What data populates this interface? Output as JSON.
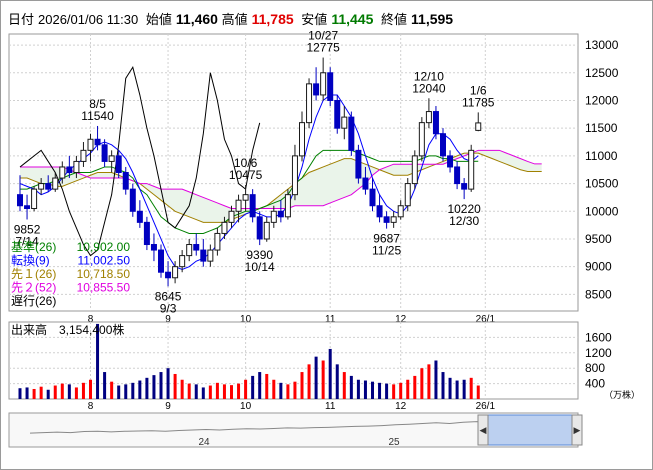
{
  "header": {
    "date_label": "日付",
    "date": "2026/01/06 11:30",
    "open_label": "始値",
    "open": "11,460",
    "high_label": "高値",
    "high": "11,785",
    "low_label": "安値",
    "low": "11,445",
    "close_label": "終値",
    "close": "11,595"
  },
  "colors": {
    "up": "#1a1a1a",
    "down": "#0000c0",
    "kijun": "#008000",
    "tenkan": "#0000ff",
    "senkou1": "#a08000",
    "senkou2": "#e000e0",
    "chikou": "#000000",
    "volume_up": "#ff0000",
    "volume_down": "#000080",
    "cloud": "#eaf4ea",
    "navigator": "#5a8ad8"
  },
  "legend": [
    {
      "label": "基準(26)",
      "value": "10,902.00",
      "color": "#008000"
    },
    {
      "label": "転換(9)",
      "value": "11,002.50",
      "color": "#0000ff"
    },
    {
      "label": "先１(26)",
      "value": "10,718.50",
      "color": "#a08000"
    },
    {
      "label": "先２(52)",
      "value": "10,855.50",
      "color": "#e000e0"
    },
    {
      "label": "遅行(26)",
      "value": "",
      "color": "#000000"
    }
  ],
  "volume_title": "出来高　3,154,400株",
  "volume_unit": "（万株）",
  "navigator": {
    "labels": [
      "24",
      "25"
    ],
    "left_arrow": "◀",
    "right_arrow": "▶"
  },
  "chart_data": {
    "type": "candlestick",
    "y_axis": {
      "ticks": [
        8500,
        9000,
        9500,
        10000,
        10500,
        11000,
        11500,
        12000,
        12500,
        13000
      ],
      "ylim": [
        8200,
        13200
      ]
    },
    "x_axis": {
      "month_labels": [
        "8",
        "9",
        "10",
        "11",
        "12",
        "26/1"
      ]
    },
    "volume_axis": {
      "ticks": [
        400,
        800,
        1200,
        1600
      ]
    },
    "annotations": [
      {
        "text": "8/5",
        "text2": "11540",
        "value": 11540
      },
      {
        "text": "9852",
        "text2": "7/14",
        "value": 9852
      },
      {
        "text": "8645",
        "text2": "9/3",
        "value": 8645
      },
      {
        "text": "10/6",
        "text2": "10475",
        "value": 10475
      },
      {
        "text": "9390",
        "text2": "10/14",
        "value": 9390
      },
      {
        "text": "10/27",
        "text2": "12775",
        "value": 12775
      },
      {
        "text": "9687",
        "text2": "11/25",
        "value": 9687
      },
      {
        "text": "12/10",
        "text2": "12040",
        "value": 12040
      },
      {
        "text": "1/6",
        "text2": "11785",
        "value": 11785
      },
      {
        "text": "10220",
        "text2": "12/30",
        "value": 10220
      }
    ],
    "candles": [
      {
        "o": 10300,
        "h": 10650,
        "l": 10000,
        "c": 10100
      },
      {
        "o": 10100,
        "h": 10300,
        "l": 9852,
        "c": 10050
      },
      {
        "o": 10050,
        "h": 10450,
        "l": 10000,
        "c": 10400
      },
      {
        "o": 10400,
        "h": 10600,
        "l": 10300,
        "c": 10500
      },
      {
        "o": 10500,
        "h": 10650,
        "l": 10350,
        "c": 10400
      },
      {
        "o": 10400,
        "h": 10700,
        "l": 10350,
        "c": 10600
      },
      {
        "o": 10600,
        "h": 10900,
        "l": 10500,
        "c": 10800
      },
      {
        "o": 10800,
        "h": 11000,
        "l": 10600,
        "c": 10700
      },
      {
        "o": 10700,
        "h": 11000,
        "l": 10600,
        "c": 10900
      },
      {
        "o": 10900,
        "h": 11250,
        "l": 10800,
        "c": 11100
      },
      {
        "o": 11100,
        "h": 11400,
        "l": 10900,
        "c": 11300
      },
      {
        "o": 11300,
        "h": 11540,
        "l": 11100,
        "c": 11200
      },
      {
        "o": 11200,
        "h": 11300,
        "l": 10800,
        "c": 10900
      },
      {
        "o": 10900,
        "h": 11100,
        "l": 10700,
        "c": 11000
      },
      {
        "o": 11000,
        "h": 11100,
        "l": 10600,
        "c": 10700
      },
      {
        "o": 10700,
        "h": 10800,
        "l": 10300,
        "c": 10400
      },
      {
        "o": 10400,
        "h": 10500,
        "l": 9900,
        "c": 10000
      },
      {
        "o": 10000,
        "h": 10200,
        "l": 9700,
        "c": 9800
      },
      {
        "o": 9800,
        "h": 9900,
        "l": 9300,
        "c": 9400
      },
      {
        "o": 9400,
        "h": 9600,
        "l": 9100,
        "c": 9300
      },
      {
        "o": 9300,
        "h": 9400,
        "l": 8800,
        "c": 8900
      },
      {
        "o": 8900,
        "h": 9100,
        "l": 8645,
        "c": 8800
      },
      {
        "o": 8800,
        "h": 9100,
        "l": 8700,
        "c": 9000
      },
      {
        "o": 9000,
        "h": 9300,
        "l": 8900,
        "c": 9200
      },
      {
        "o": 9200,
        "h": 9500,
        "l": 9100,
        "c": 9400
      },
      {
        "o": 9400,
        "h": 9600,
        "l": 9200,
        "c": 9300
      },
      {
        "o": 9300,
        "h": 9500,
        "l": 9000,
        "c": 9100
      },
      {
        "o": 9100,
        "h": 9400,
        "l": 9000,
        "c": 9300
      },
      {
        "o": 9300,
        "h": 9700,
        "l": 9200,
        "c": 9600
      },
      {
        "o": 9600,
        "h": 9900,
        "l": 9500,
        "c": 9800
      },
      {
        "o": 9800,
        "h": 10100,
        "l": 9700,
        "c": 10000
      },
      {
        "o": 10000,
        "h": 10300,
        "l": 9800,
        "c": 10200
      },
      {
        "o": 10200,
        "h": 10475,
        "l": 10000,
        "c": 10300
      },
      {
        "o": 10300,
        "h": 10400,
        "l": 9800,
        "c": 9900
      },
      {
        "o": 9900,
        "h": 10000,
        "l": 9390,
        "c": 9500
      },
      {
        "o": 9500,
        "h": 9900,
        "l": 9450,
        "c": 9800
      },
      {
        "o": 9800,
        "h": 10100,
        "l": 9700,
        "c": 10000
      },
      {
        "o": 10000,
        "h": 10200,
        "l": 9800,
        "c": 9900
      },
      {
        "o": 9900,
        "h": 10400,
        "l": 9850,
        "c": 10300
      },
      {
        "o": 10300,
        "h": 11200,
        "l": 10200,
        "c": 11000
      },
      {
        "o": 11000,
        "h": 11800,
        "l": 10900,
        "c": 11600
      },
      {
        "o": 11600,
        "h": 12400,
        "l": 11500,
        "c": 12300
      },
      {
        "o": 12300,
        "h": 12600,
        "l": 12000,
        "c": 12100
      },
      {
        "o": 12100,
        "h": 12775,
        "l": 12000,
        "c": 12500
      },
      {
        "o": 12500,
        "h": 12600,
        "l": 11900,
        "c": 12000
      },
      {
        "o": 12000,
        "h": 12100,
        "l": 11400,
        "c": 11500
      },
      {
        "o": 11500,
        "h": 11900,
        "l": 11300,
        "c": 11700
      },
      {
        "o": 11700,
        "h": 11800,
        "l": 11000,
        "c": 11100
      },
      {
        "o": 11100,
        "h": 11200,
        "l": 10500,
        "c": 10600
      },
      {
        "o": 10600,
        "h": 10800,
        "l": 10300,
        "c": 10400
      },
      {
        "o": 10400,
        "h": 10600,
        "l": 10000,
        "c": 10100
      },
      {
        "o": 10100,
        "h": 10300,
        "l": 9800,
        "c": 9900
      },
      {
        "o": 9900,
        "h": 10000,
        "l": 9687,
        "c": 9800
      },
      {
        "o": 9800,
        "h": 10000,
        "l": 9700,
        "c": 9900
      },
      {
        "o": 9900,
        "h": 10200,
        "l": 9850,
        "c": 10100
      },
      {
        "o": 10100,
        "h": 10600,
        "l": 10000,
        "c": 10500
      },
      {
        "o": 10500,
        "h": 11100,
        "l": 10400,
        "c": 11000
      },
      {
        "o": 11000,
        "h": 11700,
        "l": 10900,
        "c": 11600
      },
      {
        "o": 11600,
        "h": 12040,
        "l": 11500,
        "c": 11800
      },
      {
        "o": 11800,
        "h": 11900,
        "l": 11300,
        "c": 11400
      },
      {
        "o": 11400,
        "h": 11500,
        "l": 10900,
        "c": 11000
      },
      {
        "o": 11000,
        "h": 11100,
        "l": 10700,
        "c": 10800
      },
      {
        "o": 10800,
        "h": 10900,
        "l": 10400,
        "c": 10500
      },
      {
        "o": 10500,
        "h": 10600,
        "l": 10220,
        "c": 10400
      },
      {
        "o": 10400,
        "h": 11200,
        "l": 10350,
        "c": 11100
      },
      {
        "o": 11460,
        "h": 11785,
        "l": 11445,
        "c": 11595
      }
    ],
    "kijun": [
      10400,
      10400,
      10450,
      10500,
      10500,
      10550,
      10600,
      10650,
      10700,
      10700,
      10700,
      10750,
      10800,
      10800,
      10750,
      10700,
      10600,
      10400,
      10300,
      10100,
      9900,
      9800,
      9700,
      9650,
      9600,
      9600,
      9600,
      9650,
      9700,
      9800,
      9900,
      9950,
      10000,
      10000,
      10050,
      10100,
      10150,
      10200,
      10300,
      10500,
      10600,
      10800,
      11000,
      11100,
      11100,
      11100,
      11100,
      11100,
      11050,
      11000,
      10950,
      10900,
      10900,
      10900,
      10900,
      10900,
      10900,
      10950,
      11000,
      11000,
      10950,
      10950,
      10900,
      10900,
      10900,
      10902
    ],
    "tenkan": [
      10500,
      10450,
      10400,
      10300,
      10350,
      10450,
      10600,
      10750,
      10850,
      10950,
      11050,
      11200,
      11250,
      11200,
      11100,
      10950,
      10700,
      10400,
      10100,
      9800,
      9500,
      9200,
      9000,
      8950,
      9000,
      9100,
      9150,
      9250,
      9400,
      9550,
      9700,
      9850,
      9950,
      10000,
      9950,
      9900,
      9900,
      9950,
      10100,
      10400,
      10800,
      11300,
      11700,
      12000,
      12100,
      12100,
      11900,
      11700,
      11400,
      11000,
      10600,
      10300,
      10100,
      10000,
      9950,
      10100,
      10400,
      10800,
      11200,
      11400,
      11400,
      11300,
      11100,
      10950,
      10900,
      11002
    ],
    "senkou1": [
      10600,
      10600,
      10550,
      10500,
      10500,
      10450,
      10450,
      10500,
      10550,
      10600,
      10650,
      10700,
      10700,
      10700,
      10650,
      10600,
      10550,
      10500,
      10400,
      10300,
      10200,
      10100,
      10000,
      9950,
      9900,
      9850,
      9800,
      9800,
      9800,
      9800,
      9850,
      9900,
      9950,
      10000,
      10050,
      10100,
      10200,
      10300,
      10400,
      10500,
      10600,
      10700,
      10750,
      10800,
      10850,
      10900,
      10950,
      10950,
      10900,
      10850,
      10800,
      10750,
      10700,
      10650,
      10650,
      10650,
      10700,
      10750,
      10800,
      10850,
      10900,
      10950,
      11000,
      11050,
      11050,
      11050,
      11000,
      10950,
      10900,
      10850,
      10800,
      10750,
      10718,
      10718,
      10718
    ],
    "senkou2": [
      10800,
      10800,
      10800,
      10800,
      10800,
      10800,
      10800,
      10750,
      10700,
      10650,
      10600,
      10600,
      10600,
      10600,
      10600,
      10600,
      10550,
      10500,
      10500,
      10450,
      10400,
      10400,
      10400,
      10400,
      10350,
      10300,
      10250,
      10200,
      10150,
      10100,
      10050,
      10050,
      10050,
      10050,
      10050,
      10050,
      10050,
      10050,
      10050,
      10100,
      10100,
      10100,
      10100,
      10100,
      10150,
      10200,
      10250,
      10300,
      10400,
      10500,
      10650,
      10750,
      10800,
      10850,
      10850,
      10850,
      10850,
      10850,
      10850,
      10850,
      10850,
      10900,
      10950,
      11000,
      11050,
      11100,
      11100,
      11100,
      11100,
      11050,
      11000,
      10950,
      10900,
      10855,
      10855
    ],
    "chikou": [
      10800,
      10900,
      11000,
      11100,
      10900,
      10700,
      10400,
      10000,
      9700,
      9400,
      9200,
      9300,
      9800,
      10300,
      11200,
      12400,
      12600,
      12100,
      11500,
      11000,
      10400,
      9800,
      9700,
      9900,
      10100,
      10600,
      11400,
      12500,
      12000,
      11300,
      11000,
      10500,
      10400,
      11100,
      11595
    ],
    "volume": [
      280,
      300,
      260,
      320,
      240,
      350,
      400,
      380,
      300,
      420,
      500,
      1950,
      700,
      450,
      350,
      380,
      420,
      480,
      550,
      620,
      700,
      800,
      650,
      500,
      400,
      380,
      300,
      350,
      420,
      380,
      360,
      400,
      500,
      600,
      700,
      650,
      500,
      420,
      380,
      450,
      700,
      900,
      1100,
      1000,
      1300,
      900,
      700,
      600,
      500,
      480,
      450,
      420,
      400,
      380,
      420,
      500,
      600,
      800,
      900,
      1000,
      700,
      550,
      480,
      500,
      550,
      350
    ],
    "navigator_series": [
      0.62,
      0.6,
      0.58,
      0.6,
      0.56,
      0.55,
      0.57,
      0.55,
      0.54,
      0.53,
      0.55,
      0.52,
      0.5,
      0.48,
      0.5,
      0.47,
      0.45,
      0.46,
      0.44,
      0.42,
      0.43,
      0.41,
      0.4,
      0.38,
      0.36,
      0.35,
      0.33,
      0.3,
      0.28,
      0.25,
      0.22,
      0.25,
      0.2,
      0.18,
      0.22,
      0.15,
      0.12,
      0.18,
      0.1,
      0.08
    ]
  }
}
